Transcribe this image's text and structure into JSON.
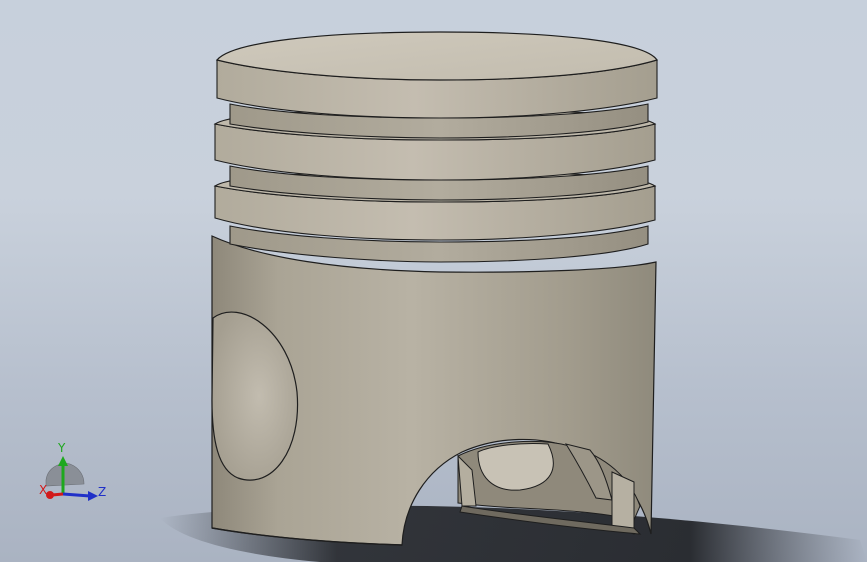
{
  "viewport": {
    "background_top": "#c7d0dc",
    "background_bottom": "#aab3c2"
  },
  "model": {
    "part": "piston",
    "ring_grooves": 3,
    "colors": {
      "body_light": "#c9c3b6",
      "body_mid": "#a8a293",
      "body_dark": "#8d8779",
      "edge": "#1e1e1e",
      "shadow": "#1c1e22"
    }
  },
  "triad": {
    "y_label": "Y",
    "x_label": "X",
    "z_label": "Z",
    "colors": {
      "x": "#d21a1a",
      "y": "#1ea81e",
      "z": "#2030c8"
    }
  }
}
